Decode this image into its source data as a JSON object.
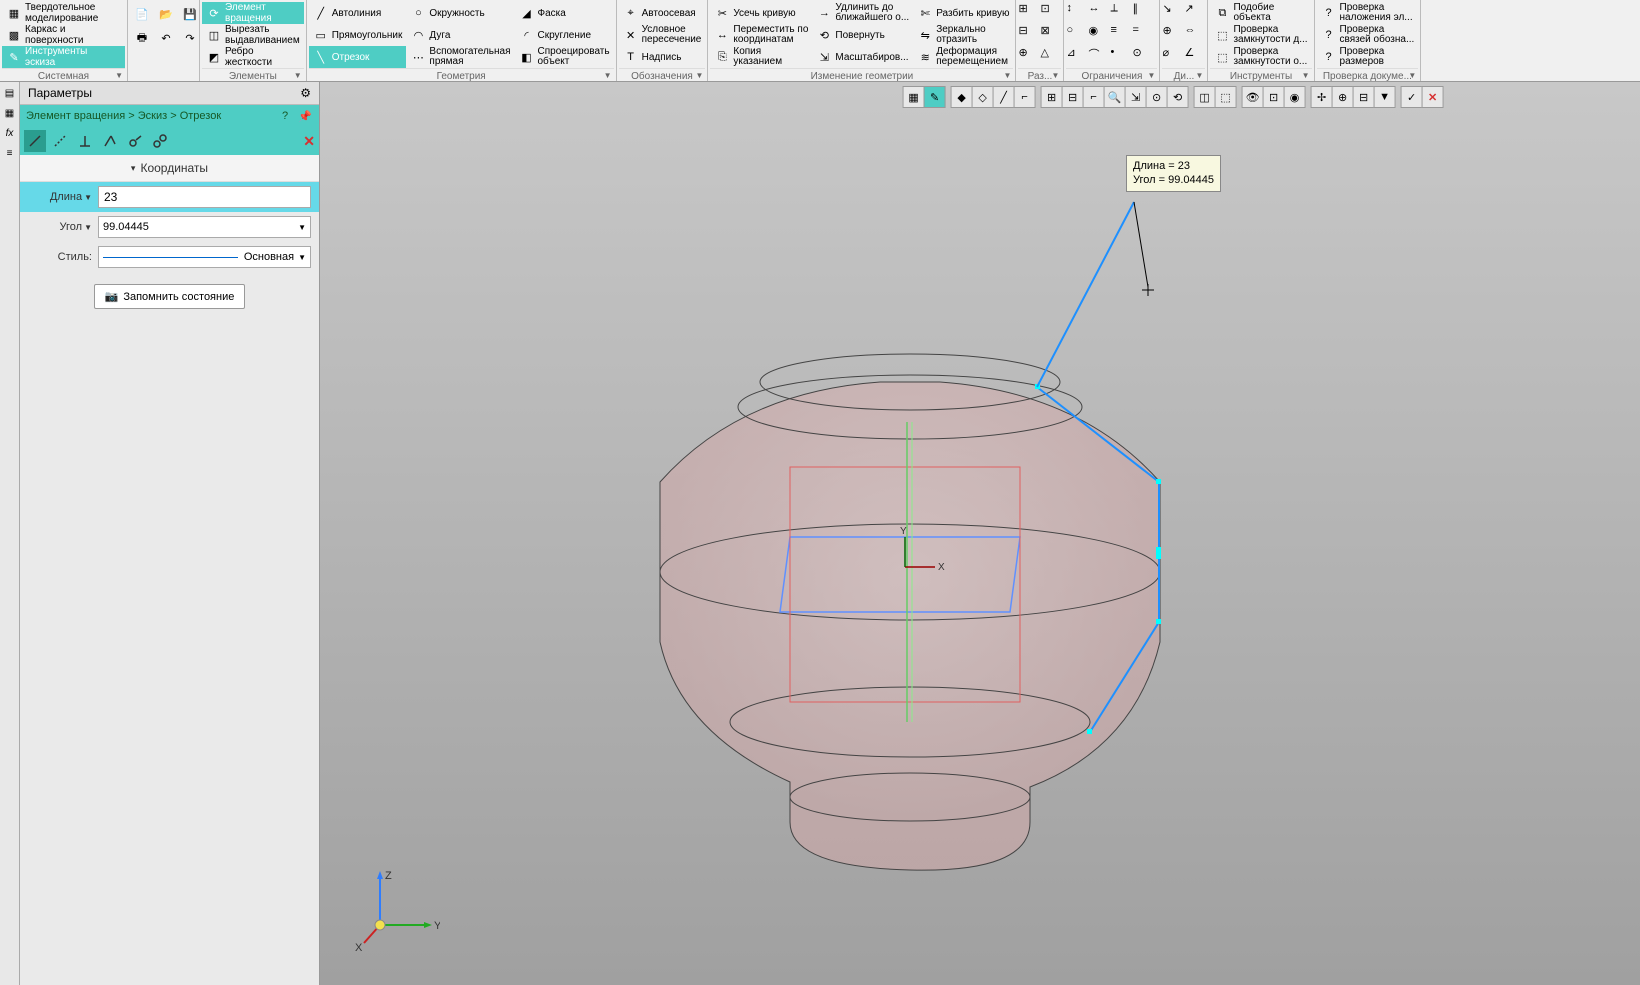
{
  "modes": {
    "solid": "Твердотельное\nмоделирование",
    "wireframe": "Каркас и\nповерхности",
    "sketch_tools": "Инструменты\nэскиза"
  },
  "toolbar_groups": {
    "system": "Системная",
    "elements": "Элементы",
    "geometry": "Геометрия",
    "labels": "Обозначения",
    "geom_edit": "Изменение геометрии",
    "layout": "Раз...",
    "constraints": "Ограничения",
    "di": "Ди...",
    "tools": "Инструменты",
    "doc_check": "Проверка докуме..."
  },
  "tools": {
    "revolve": "Элемент\nвращения",
    "extrude_cut": "Вырезать\nвыдавливанием",
    "rib": "Ребро\nжесткости",
    "autoline": "Автолиния",
    "rectangle": "Прямоугольник",
    "segment": "Отрезок",
    "circle": "Окружность",
    "arc": "Дуга",
    "aux_line": "Вспомогательная\nпрямая",
    "chamfer": "Фаска",
    "fillet": "Скругление",
    "project": "Спроецировать\nобъект",
    "auto_axis": "Автоосевая",
    "cond_intersect": "Условное\nпересечение",
    "text": "Надпись",
    "trim": "Усечь кривую",
    "move_coords": "Переместить по\nкоординатам",
    "copy_ref": "Копия\nуказанием",
    "extend": "Удлинить до\nближайшего о...",
    "rotate": "Повернуть",
    "scale": "Масштабиров...",
    "split": "Разбить кривую",
    "mirror": "Зеркально\nотразить",
    "deform": "Деформация\nперемещением",
    "similar": "Подобие\nобъекта",
    "check_closed_d": "Проверка\nзамкнутости д...",
    "check_closed_o": "Проверка\nзамкнутости о...",
    "check_overlap": "Проверка\nналожения эл...",
    "check_links": "Проверка\nсвязей обозна...",
    "check_dims": "Проверка\nразмеров"
  },
  "panel": {
    "title": "Параметры",
    "breadcrumb": "Элемент вращения > Эскиз > Отрезок",
    "section_coords": "Координаты",
    "label_length": "Длина",
    "label_angle": "Угол",
    "label_style": "Стиль:",
    "value_length": "23",
    "value_angle": "99.04445",
    "value_style": "Основная",
    "remember": "Запомнить состояние"
  },
  "annotation": {
    "line1": "Длина = 23",
    "line2": "Угол = 99.04445"
  },
  "axis": {
    "x": "X",
    "y": "Y",
    "z": "Z"
  }
}
